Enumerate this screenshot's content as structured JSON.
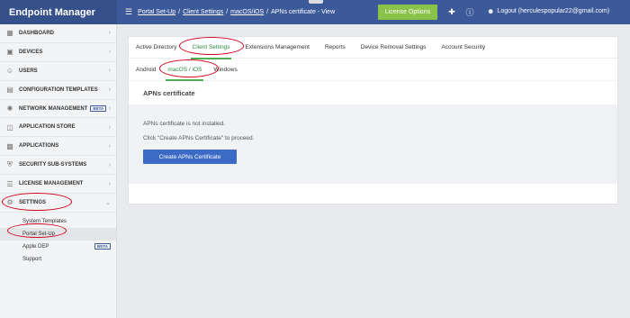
{
  "app": {
    "title": "Endpoint Manager"
  },
  "breadcrumb": {
    "items": [
      "Portal Set-Up",
      "Client Settings",
      "macOS/iOS"
    ],
    "current": "APNs certificate - View"
  },
  "topbar": {
    "license_label": "License Options",
    "logout_label": "Logout (herculespopular22@gmail.com)"
  },
  "sidebar": {
    "items": [
      {
        "label": "DASHBOARD",
        "icon": "dashboard-icon"
      },
      {
        "label": "DEVICES",
        "icon": "devices-icon"
      },
      {
        "label": "USERS",
        "icon": "users-icon"
      },
      {
        "label": "CONFIGURATION TEMPLATES",
        "icon": "templates-icon"
      },
      {
        "label": "NETWORK MANAGEMENT",
        "icon": "network-icon",
        "badge": "BETA"
      },
      {
        "label": "APPLICATION STORE",
        "icon": "store-icon"
      },
      {
        "label": "APPLICATIONS",
        "icon": "applications-icon"
      },
      {
        "label": "SECURITY SUB-SYSTEMS",
        "icon": "shield-icon"
      },
      {
        "label": "LICENSE MANAGEMENT",
        "icon": "license-icon"
      },
      {
        "label": "SETTINGS",
        "icon": "gear-icon"
      }
    ],
    "settings_sub": [
      {
        "label": "System Templates"
      },
      {
        "label": "Portal Set-Up"
      },
      {
        "label": "Apple DEP",
        "badge": "BETA"
      },
      {
        "label": "Support"
      }
    ]
  },
  "tabs": [
    "Active Directory",
    "Client Settings",
    "Extensions Management",
    "Reports",
    "Device Removal Settings",
    "Account Security"
  ],
  "subtabs": [
    "Android",
    "macOS / iOS",
    "Windows"
  ],
  "section": {
    "title": "APNs certificate",
    "line1": "APNs certificate is not installed.",
    "line2": "Click \"Create APNs Certificate\" to proceed.",
    "button": "Create APNs Certificate"
  },
  "colors": {
    "topbar": "#3c5a99",
    "accent_green": "#8bc34a",
    "button_blue": "#3c6bc6",
    "highlight_red": "#d0021b"
  }
}
